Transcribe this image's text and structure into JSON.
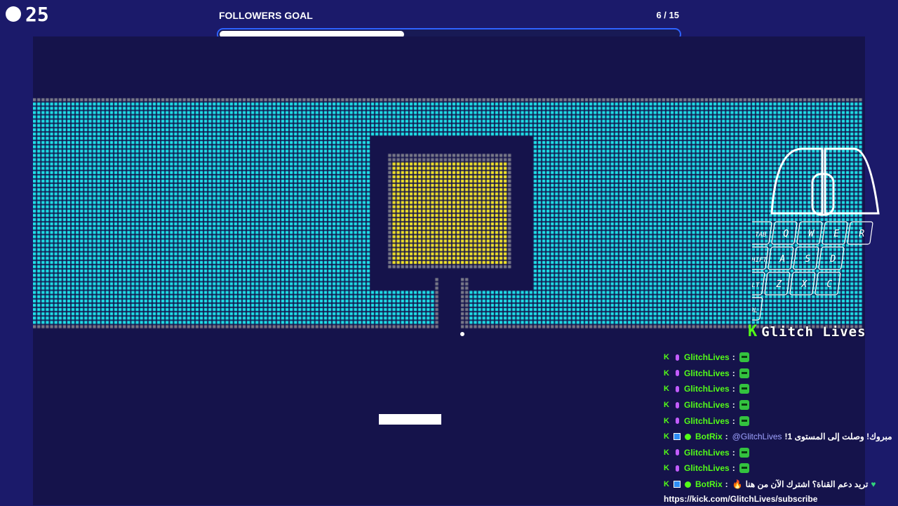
{
  "hud": {
    "ball_count": "25",
    "goal_title": "FOLLOWERS GOAL",
    "goal_count": "6 / 15",
    "goal_progress": 0.4
  },
  "colors": {
    "brick_cyan": "#1fe3ea",
    "brick_gray": "#7b7b8a",
    "brick_yellow": "#f3e52a",
    "field_bg": "#15134b",
    "page_bg": "#1b1a6a",
    "accent_blue": "#2e63ff",
    "kick_green": "#53fc18"
  },
  "overlay": {
    "keys": [
      "TAB",
      "Q",
      "W",
      "E",
      "R",
      "SHIFT",
      "A",
      "S",
      "D",
      "ALT",
      "Z",
      "X",
      "C",
      "CTRL"
    ],
    "channel_logo": "K",
    "channel_name": "Glitch Lives"
  },
  "chat": {
    "messages": [
      {
        "user": "GlitchLives",
        "sep": ":",
        "emote": "sticker-emote"
      },
      {
        "user": "GlitchLives",
        "sep": ":",
        "emote": "sticker-emote"
      },
      {
        "user": "GlitchLives",
        "sep": ":",
        "emote": "sticker-emote"
      },
      {
        "user": "GlitchLives",
        "sep": ":",
        "emote": "sticker-emote"
      },
      {
        "user": "GlitchLives",
        "sep": ":",
        "emote": "sticker-emote"
      },
      {
        "user": "BotRix",
        "sep": ":",
        "mention": "@GlitchLives",
        "text": "مبروك! وصلت إلى المستوى 1!"
      },
      {
        "user": "GlitchLives",
        "sep": ":",
        "emote": "sticker-emote"
      },
      {
        "user": "GlitchLives",
        "sep": ":",
        "emote": "sticker-emote"
      },
      {
        "user": "BotRix",
        "sep": ":",
        "text": "تريد دعم القناة؟ اشترك الآن من هنا"
      }
    ],
    "link": "https://kick.com/GlitchLives/subscribe"
  }
}
